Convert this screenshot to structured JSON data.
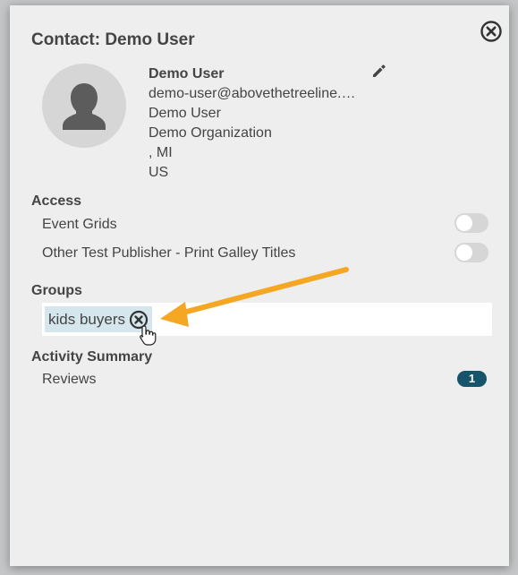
{
  "modal": {
    "title": "Contact: Demo User",
    "close_icon": "close-circle-icon"
  },
  "contact": {
    "name": "Demo User",
    "email": "demo-user@abovethetreeline.…",
    "display_name": "Demo User",
    "organization": "Demo Organization",
    "location": ", MI",
    "country": "US",
    "edit_icon": "pencil-icon",
    "avatar_icon": "person-silhouette-icon"
  },
  "access": {
    "title": "Access",
    "items": [
      {
        "label": "Event Grids",
        "enabled": false
      },
      {
        "label": "Other Test Publisher - Print Galley Titles",
        "enabled": false
      }
    ]
  },
  "groups": {
    "title": "Groups",
    "tags": [
      {
        "label": "kids buyers",
        "remove_icon": "remove-circle-icon"
      }
    ]
  },
  "activity": {
    "title": "Activity Summary",
    "items": [
      {
        "label": "Reviews",
        "count": "1"
      }
    ]
  },
  "colors": {
    "badge": "#16546b",
    "tag_bg": "#d5e6ed",
    "annotation_arrow": "#f5a623"
  }
}
